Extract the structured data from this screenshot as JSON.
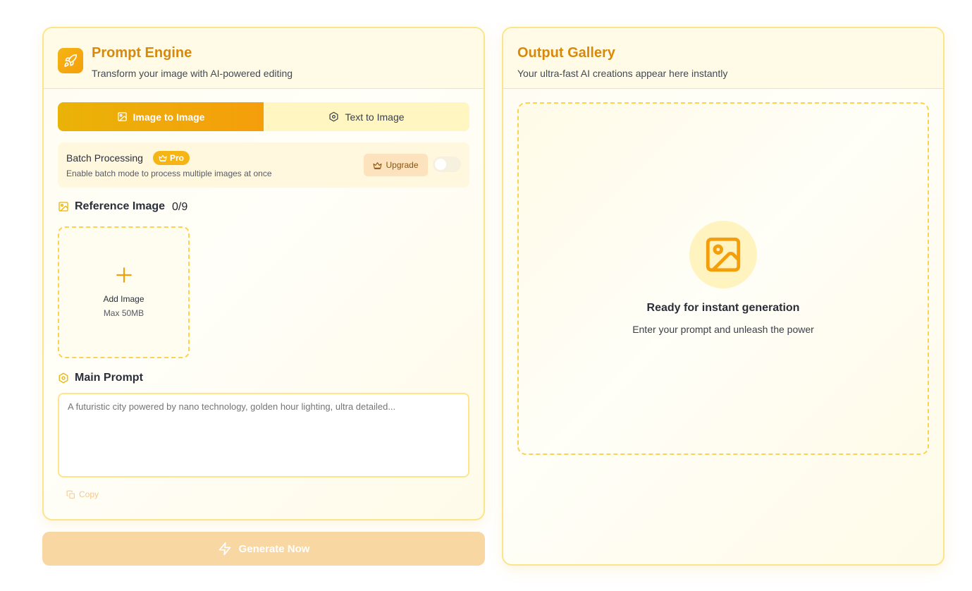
{
  "prompt_engine": {
    "title": "Prompt Engine",
    "subtitle": "Transform your image with AI-powered editing",
    "tabs": [
      {
        "label": "Image to Image",
        "active": true
      },
      {
        "label": "Text to Image",
        "active": false
      }
    ],
    "batch": {
      "title": "Batch Processing",
      "badge": "Pro",
      "description": "Enable batch mode to process multiple images at once",
      "upgrade_label": "Upgrade",
      "enabled": false
    },
    "reference": {
      "label": "Reference Image",
      "count": "0/9",
      "add_label": "Add Image",
      "max_label": "Max 50MB"
    },
    "prompt": {
      "label": "Main Prompt",
      "placeholder": "A futuristic city powered by nano technology, golden hour lighting, ultra detailed...",
      "copy_label": "Copy"
    }
  },
  "generate_label": "Generate Now",
  "gallery": {
    "title": "Output Gallery",
    "subtitle": "Your ultra-fast AI creations appear here instantly",
    "empty_title": "Ready for instant generation",
    "empty_subtitle": "Enter your prompt and unleash the power"
  },
  "colors": {
    "accent": "#f59e0b",
    "title": "#d9890a",
    "border": "#fbe58a"
  }
}
